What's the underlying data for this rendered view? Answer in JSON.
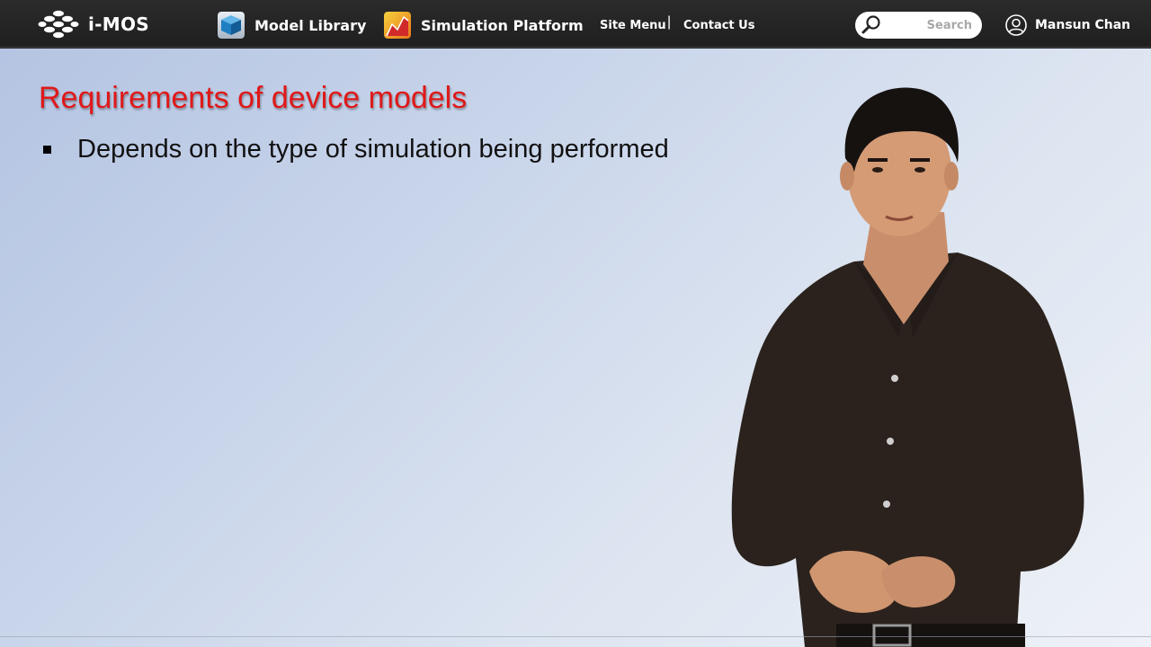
{
  "navbar": {
    "brand": "i-MOS",
    "links": [
      {
        "label": "Model Library",
        "icon": "cube-icon"
      },
      {
        "label": "Simulation Platform",
        "icon": "chart-icon"
      }
    ],
    "site_menu": "Site Menu",
    "separator": "|",
    "contact": "Contact Us",
    "search_placeholder": "Search",
    "user_name": "Mansun Chan"
  },
  "slide": {
    "title": "Requirements of device models",
    "bullets": [
      "Depends on the type of simulation being performed"
    ]
  },
  "colors": {
    "navbar_bg": "#232323",
    "title_red": "#e01818",
    "slide_bg_start": "#b4c4e2",
    "slide_bg_end": "#eef1f7"
  }
}
